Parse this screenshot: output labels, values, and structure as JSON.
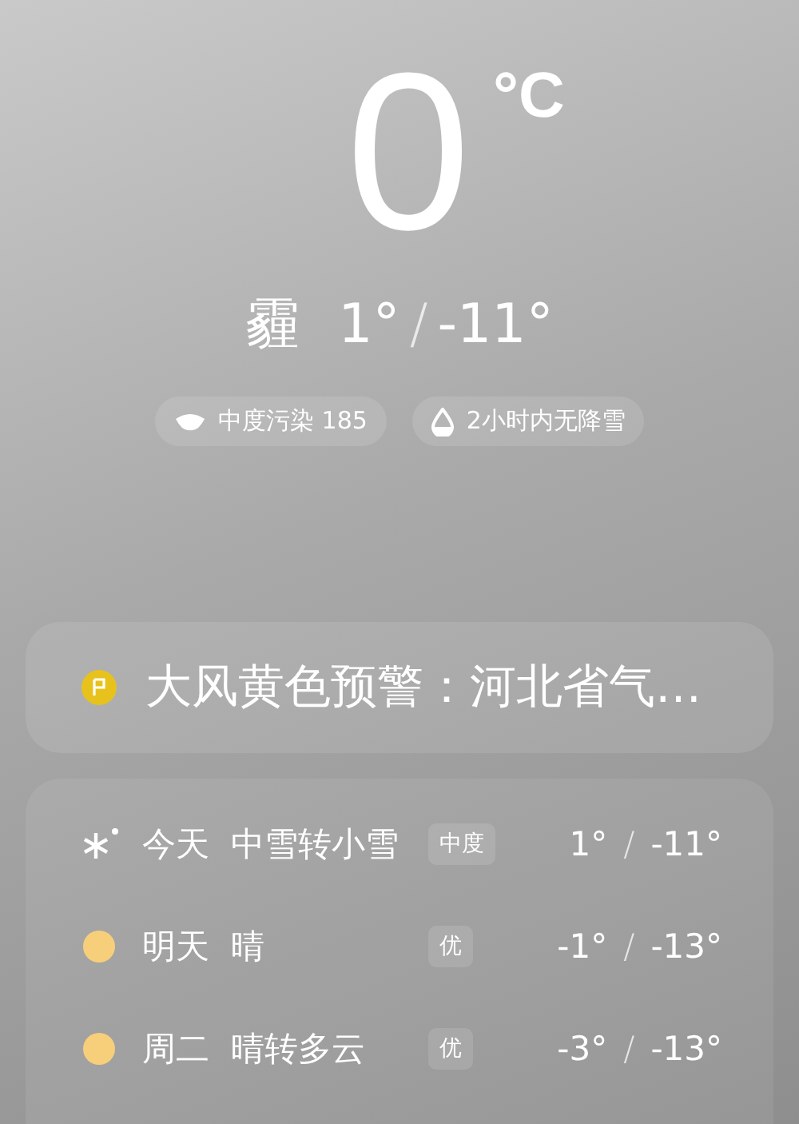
{
  "current": {
    "temperature": "0",
    "unit": "°C",
    "condition": "霾",
    "high": "1°",
    "separator": "/",
    "low": "-11°"
  },
  "chips": [
    {
      "kind": "mask",
      "label": "中度污染 185"
    },
    {
      "kind": "drop",
      "label": "2小时内无降雪"
    }
  ],
  "alert": {
    "color": "#e8c21c",
    "text": "大风黄色预警：河北省气…"
  },
  "forecast": [
    {
      "kind": "snow",
      "day": "今天",
      "condition": "中雪转小雪",
      "air": "中度",
      "high": "1°",
      "separator": "/",
      "low": "-11°"
    },
    {
      "kind": "sun",
      "day": "明天",
      "condition": "晴",
      "air": "优",
      "high": "-1°",
      "separator": "/",
      "low": "-13°"
    },
    {
      "kind": "sun",
      "day": "周二",
      "condition": "晴转多云",
      "air": "优",
      "high": "-3°",
      "separator": "/",
      "low": "-13°"
    }
  ]
}
